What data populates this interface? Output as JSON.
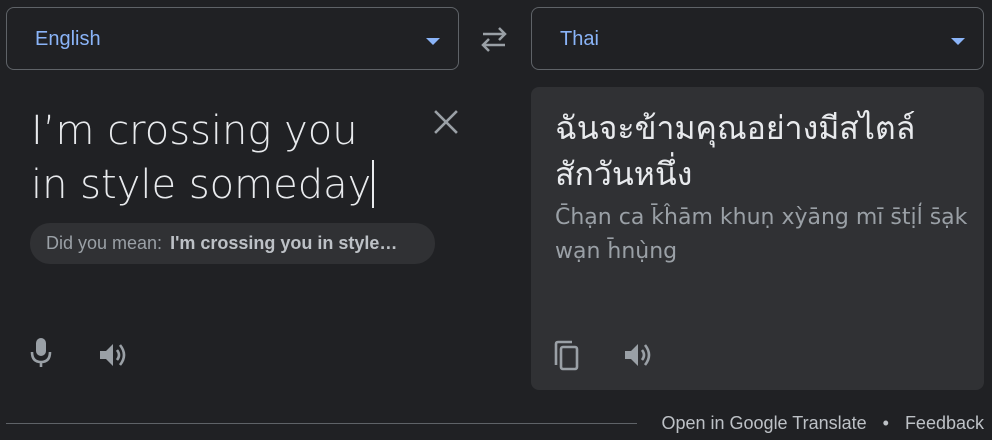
{
  "source": {
    "language": "English",
    "text_lines": [
      "I’m crossing you",
      "in style someday"
    ],
    "did_you_mean_prefix": "Did you mean:",
    "did_you_mean_suggestion": "I'm crossing you in style…"
  },
  "target": {
    "language": "Thai",
    "text_lines": [
      "ฉันจะข้ามคุณอย่างมีสไตล์",
      "สักวันหนึ่ง"
    ],
    "transliteration_lines": [
      "C̄hạn ca k̄ĥām khuṇ xỳāng mī s̄tịl̒ s̄ạk",
      "wạn h̄nụ̀ng"
    ]
  },
  "footer": {
    "open_link": "Open in Google Translate",
    "separator": "•",
    "feedback_link": "Feedback"
  },
  "icons": {
    "swap": "swap-arrows-icon",
    "clear": "close-icon",
    "mic": "microphone-icon",
    "listen": "speaker-icon",
    "copy": "copy-icon",
    "dropdown": "caret-down-icon"
  },
  "colors": {
    "background": "#202124",
    "panel": "#303134",
    "accent": "#8ab4f8",
    "text_primary": "#e8eaed",
    "text_secondary": "#9aa0a6"
  }
}
